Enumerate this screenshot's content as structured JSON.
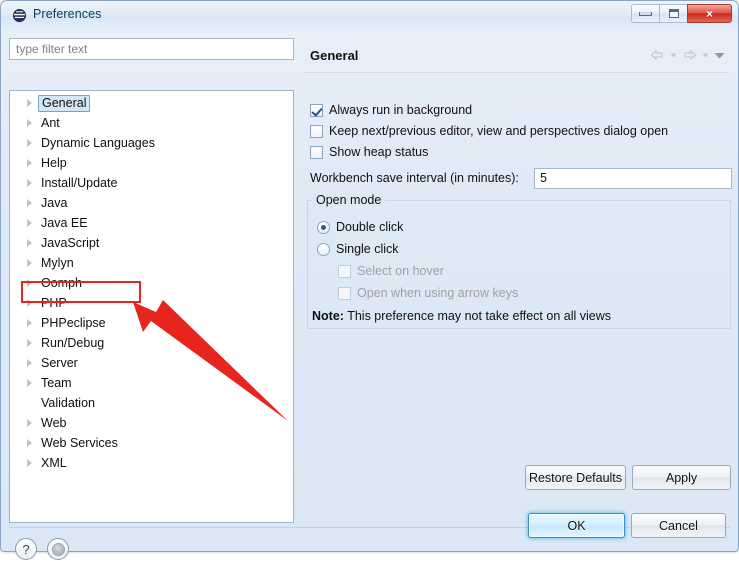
{
  "window": {
    "title": "Preferences",
    "icon": "eclipse-icon",
    "controls": {
      "minimize": "minimize-icon",
      "maximize": "maximize-icon",
      "close": "×"
    }
  },
  "filter": {
    "placeholder": "type filter text",
    "value": ""
  },
  "tree": {
    "items": [
      {
        "label": "General",
        "expandable": true,
        "selected": true
      },
      {
        "label": "Ant",
        "expandable": true,
        "selected": false
      },
      {
        "label": "Dynamic Languages",
        "expandable": true,
        "selected": false
      },
      {
        "label": "Help",
        "expandable": true,
        "selected": false
      },
      {
        "label": "Install/Update",
        "expandable": true,
        "selected": false
      },
      {
        "label": "Java",
        "expandable": true,
        "selected": false
      },
      {
        "label": "Java EE",
        "expandable": true,
        "selected": false
      },
      {
        "label": "JavaScript",
        "expandable": true,
        "selected": false
      },
      {
        "label": "Mylyn",
        "expandable": true,
        "selected": false
      },
      {
        "label": "Oomph",
        "expandable": true,
        "selected": false
      },
      {
        "label": "PHP",
        "expandable": true,
        "selected": false
      },
      {
        "label": "PHPeclipse",
        "expandable": true,
        "selected": false
      },
      {
        "label": "Run/Debug",
        "expandable": true,
        "selected": false
      },
      {
        "label": "Server",
        "expandable": true,
        "selected": false
      },
      {
        "label": "Team",
        "expandable": true,
        "selected": false
      },
      {
        "label": "Validation",
        "expandable": false,
        "selected": false
      },
      {
        "label": "Web",
        "expandable": true,
        "selected": false
      },
      {
        "label": "Web Services",
        "expandable": true,
        "selected": false
      },
      {
        "label": "XML",
        "expandable": true,
        "selected": false
      }
    ]
  },
  "page": {
    "title": "General",
    "nav": {
      "back": "back-arrow-icon",
      "back_menu": "chevron-down-icon",
      "forward": "forward-arrow-icon",
      "forward_menu": "chevron-down-icon",
      "view_menu": "view-menu-icon"
    },
    "checkboxes": [
      {
        "label": "Always run in background",
        "checked": true,
        "enabled": true
      },
      {
        "label": "Keep next/previous editor, view and perspectives dialog open",
        "checked": false,
        "enabled": true
      },
      {
        "label": "Show heap status",
        "checked": false,
        "enabled": true
      }
    ],
    "save_interval": {
      "label": "Workbench save interval (in minutes):",
      "value": "5"
    },
    "open_mode": {
      "title": "Open mode",
      "radios": [
        {
          "label": "Double click",
          "selected": true
        },
        {
          "label": "Single click",
          "selected": false
        }
      ],
      "sub_checkboxes": [
        {
          "label": "Select on hover",
          "checked": false,
          "enabled": false
        },
        {
          "label": "Open when using arrow keys",
          "checked": false,
          "enabled": false
        }
      ],
      "note_prefix": "Note:",
      "note_text": "This preference may not take effect on all views"
    },
    "buttons": {
      "restore_defaults": "Restore Defaults",
      "apply": "Apply"
    }
  },
  "footer": {
    "help": "?",
    "record": "record-icon",
    "ok": "OK",
    "cancel": "Cancel"
  },
  "annotation": {
    "highlight_target": "PHPeclipse",
    "color": "#e8241f",
    "arrow": "red-arrow-pointing-to-phpeclipse"
  }
}
